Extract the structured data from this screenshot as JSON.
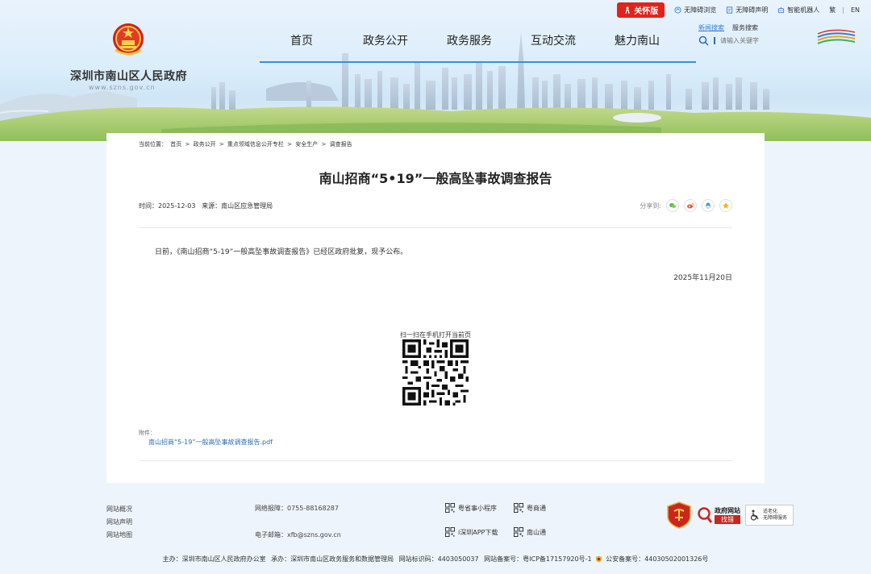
{
  "header": {
    "site_name": "深圳市南山区人民政府",
    "site_url": "www.szns.gov.cn",
    "care_label": "关怀版",
    "accessible_browse": "无障碍浏览",
    "accessible_statement": "无障碍声明",
    "smart_robot": "智能机器人",
    "lang_traditional": "繁",
    "lang_en": "EN"
  },
  "nav": {
    "items": [
      "首页",
      "政务公开",
      "政务服务",
      "互动交流",
      "魅力南山"
    ]
  },
  "search": {
    "tab_news": "新闻搜索",
    "tab_service": "服务搜索",
    "placeholder": "请输入关键字"
  },
  "breadcrumb": {
    "prefix": "当前位置：",
    "items": [
      "首页",
      "政务公开",
      "重点领域信息公开专栏",
      "安全生产",
      "调查报告"
    ],
    "separator": ">"
  },
  "article": {
    "title": "南山招商“5•19”一般高坠事故调查报告",
    "meta": "时间：2025-12-03   来源：南山区应急管理局",
    "share_label": "分享到:",
    "paragraph": "日前，《南山招商“5-19”一般高坠事故调查报告》已经区政府批复，现予公布。",
    "date": "2025年11月20日",
    "qr_caption": "扫一扫在手机打开当前页",
    "attachment_label": "附件：",
    "attachment_link": "南山招商“5-19”一般高坠事故调查报告.pdf"
  },
  "footer": {
    "links": [
      "网站概况",
      "网站声明",
      "网站地图"
    ],
    "report_phone": "网络报障：0755-88168287",
    "email": "电子邮箱：xfb@szns.gov.cn",
    "apps": [
      "粤省事小程序",
      "粤商通",
      "i深圳APP下载",
      "南山通"
    ],
    "badge_zfwz_top": "政府网站",
    "badge_zfwz_bottom": "找错",
    "badge_acc_line1": "适老化",
    "badge_acc_line2": "无障碍服务",
    "bottom_host": "主办：深圳市南山区人民政府办公室",
    "bottom_undertake": "承办：深圳市南山区政务服务和数据管理局",
    "bottom_id": "网站标识码：4403050037",
    "bottom_icp": "网站备案号：粤ICP备17157920号-1",
    "bottom_police": "公安备案号：44030502001326号"
  },
  "colors": {
    "nav_line": "#3a8fd8",
    "care_red": "#e0231d",
    "link_blue": "#2d6ab4"
  }
}
